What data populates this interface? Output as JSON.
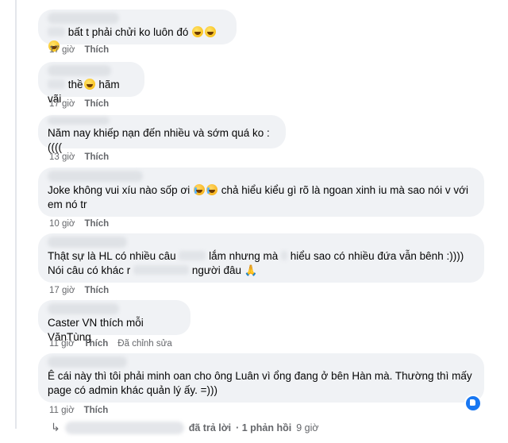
{
  "comments": [
    {
      "text_before": "bất t phải chửi ko luôn đó",
      "time": "17 giờ",
      "like": "Thích"
    },
    {
      "text_a": "thề",
      "text_b": "hãm vãi",
      "time": "17 giờ",
      "like": "Thích"
    },
    {
      "text": "Năm nay khiếp nạn đến nhiều và sớm quá ko :((((",
      "time": "13 giờ",
      "like": "Thích"
    },
    {
      "text_a": "Joke không vui xíu nào sốp ơi",
      "text_b": "chả hiểu kiểu gì rõ là ngoan xinh iu mà sao nói v với em nó tr",
      "time": "10 giờ",
      "like": "Thích"
    },
    {
      "text_a": "Thật sự là HL có nhiều câu",
      "text_b": "lắm nhưng mà",
      "text_c": "hiểu sao có nhiều đứa vẫn bênh :)))) Nói câu có khác r",
      "text_d": "người đâu 🙏",
      "time": "17 giờ",
      "like": "Thích"
    },
    {
      "text": "Caster VN thích mỗi VănTùng",
      "time": "11 giờ",
      "like": "Thích",
      "edited": "Đã chỉnh sửa"
    },
    {
      "text": "Ê cái này thì tôi phải minh oan cho ông Luân vì ổng đang ở bên Hàn mà. Thường thì mấy page có admin khác quản lý ấy. =)))",
      "time": "11 giờ",
      "like": "Thích"
    }
  ],
  "reply_bar": {
    "replied": "đã trả lời",
    "count": "· 1 phản hồi",
    "time": "9 giờ"
  },
  "colors": {
    "bubble": "#f0f2f5",
    "meta": "#65676b",
    "badge": "#1877f2"
  }
}
